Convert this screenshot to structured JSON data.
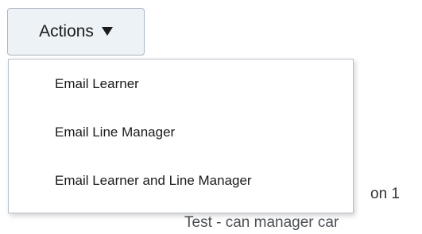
{
  "actions_button": {
    "label": "Actions",
    "icon": "caret-down-icon"
  },
  "dropdown": {
    "items": [
      {
        "label": "Email Learner"
      },
      {
        "label": "Email Line Manager"
      },
      {
        "label": "Email Learner and Line Manager"
      }
    ]
  },
  "background": {
    "fragment_1": "on 1",
    "fragment_2": "Test - can manager car"
  }
}
